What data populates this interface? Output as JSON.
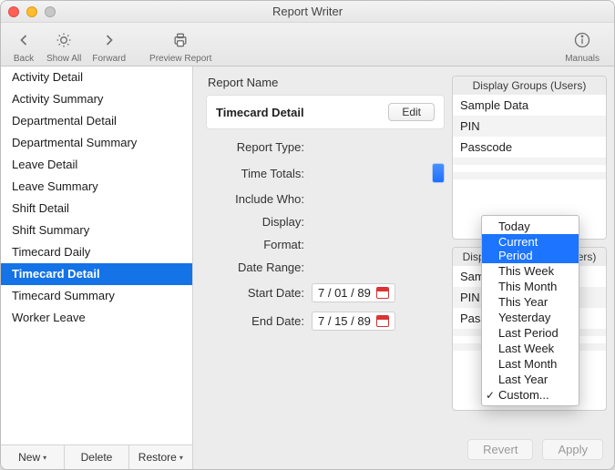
{
  "window": {
    "title": "Report Writer"
  },
  "toolbar": {
    "back": "Back",
    "showall": "Show All",
    "forward": "Forward",
    "preview": "Preview Report",
    "manuals": "Manuals"
  },
  "sidebar": {
    "items": [
      "Activity Detail",
      "Activity Summary",
      "Departmental Detail",
      "Departmental Summary",
      "Leave Detail",
      "Leave Summary",
      "Shift Detail",
      "Shift Summary",
      "Timecard Daily",
      "Timecard Detail",
      "Timecard Summary",
      "Worker Leave"
    ],
    "selectedIndex": 9,
    "footer": {
      "new": "New",
      "delete": "Delete",
      "restore": "Restore"
    }
  },
  "center": {
    "reportNameLabel": "Report Name",
    "reportName": "Timecard Detail",
    "edit": "Edit",
    "fields": {
      "reportType": "Report Type:",
      "timeTotals": "Time Totals:",
      "includeWho": "Include Who:",
      "display": "Display:",
      "format": "Format:",
      "dateRange": "Date Range:",
      "startDate": "Start Date:",
      "endDate": "End Date:"
    },
    "startDateValue": "7 / 01 / 89",
    "endDateValue": "7 / 15 / 89"
  },
  "dropdown": {
    "items": [
      "Today",
      "Current Period",
      "This Week",
      "This Month",
      "This Year",
      "Yesterday",
      "Last Period",
      "Last Week",
      "Last Month",
      "Last Year",
      "Custom..."
    ],
    "highlightedIndex": 1,
    "checkedIndex": 10
  },
  "panel_users": {
    "title": "Display Groups (Users)",
    "items": [
      "Sample Data",
      "PIN",
      "Passcode"
    ]
  },
  "panel_managers": {
    "title": "Display Groups (Managers)",
    "items": [
      "Sample Data",
      "PIN",
      "Passcode"
    ]
  },
  "footer": {
    "revert": "Revert",
    "apply": "Apply"
  }
}
